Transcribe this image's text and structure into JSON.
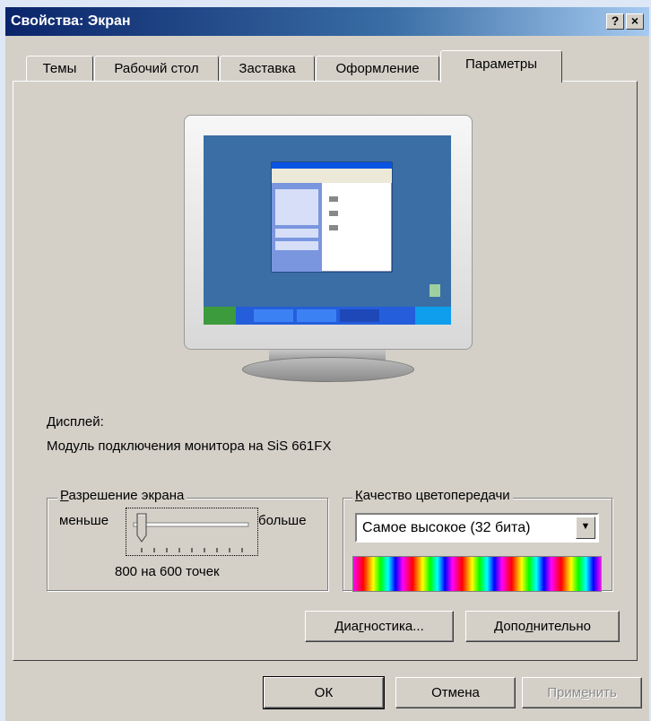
{
  "window": {
    "title": "Свойства: Экран"
  },
  "titlebar": {
    "help_label": "?",
    "close_label": "×"
  },
  "tabs": [
    {
      "label": "Темы"
    },
    {
      "label": "Рабочий стол"
    },
    {
      "label": "Заставка"
    },
    {
      "label": "Оформление"
    },
    {
      "label": "Параметры",
      "active": true
    }
  ],
  "display": {
    "label": "Дисплей:",
    "name": "Модуль подключения монитора на SiS 661FX"
  },
  "resolution": {
    "title_underlined": "Р",
    "title_rest": "азрешение экрана",
    "less": "меньше",
    "more": "больше",
    "value_text": "800 на 600 точек",
    "slider_level": 0
  },
  "color_quality": {
    "title_underlined": "К",
    "title_rest": "ачество цветопередачи",
    "selected": "Самое высокое (32 бита)"
  },
  "buttons": {
    "diagnostics_pre": "Диа",
    "diagnostics_u": "г",
    "diagnostics_post": "ностика...",
    "advanced_pre": "Допо",
    "advanced_u": "л",
    "advanced_post": "нительно",
    "ok": "ОК",
    "cancel": "Отмена",
    "apply_pre": "Прим",
    "apply_u": "е",
    "apply_post": "нить"
  },
  "colors": {
    "title_bar": "#0a246a",
    "face": "#d4d0c8",
    "desktop": "#3a6ea5"
  },
  "icons": [
    "help-icon",
    "close-icon",
    "monitor-icon",
    "slider-thumb-icon",
    "dropdown-arrow-icon"
  ]
}
